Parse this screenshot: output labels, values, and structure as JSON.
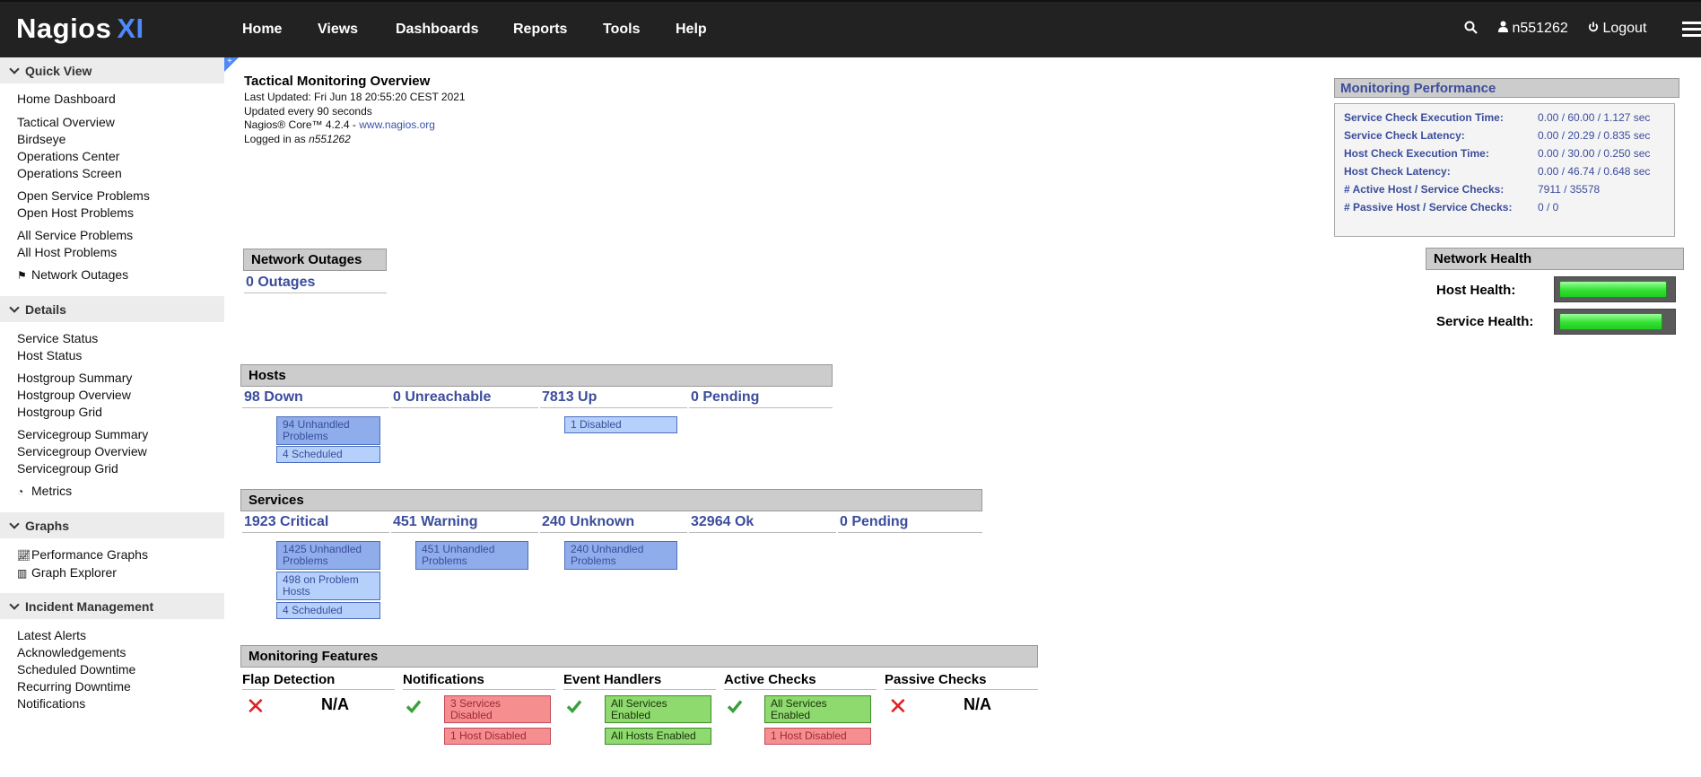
{
  "header": {
    "logo_main": "Nagios",
    "logo_xi": "XI",
    "nav": [
      "Home",
      "Views",
      "Dashboards",
      "Reports",
      "Tools",
      "Help"
    ],
    "username": "n551262",
    "logout_label": "Logout"
  },
  "sidebar": {
    "quick_view": {
      "title": "Quick View",
      "items": [
        "Home Dashboard",
        "Tactical Overview",
        "Birdseye",
        "Operations Center",
        "Operations Screen",
        "Open Service Problems",
        "Open Host Problems",
        "All Service Problems",
        "All Host Problems",
        "Network Outages"
      ]
    },
    "details": {
      "title": "Details",
      "items": [
        "Service Status",
        "Host Status",
        "Hostgroup Summary",
        "Hostgroup Overview",
        "Hostgroup Grid",
        "Servicegroup Summary",
        "Servicegroup Overview",
        "Servicegroup Grid",
        "Metrics"
      ]
    },
    "graphs": {
      "title": "Graphs",
      "items": [
        "Performance Graphs",
        "Graph Explorer"
      ]
    },
    "incident": {
      "title": "Incident Management",
      "items": [
        "Latest Alerts",
        "Acknowledgements",
        "Scheduled Downtime",
        "Recurring Downtime",
        "Notifications"
      ]
    }
  },
  "overview": {
    "title": "Tactical Monitoring Overview",
    "last_updated": "Last Updated: Fri Jun 18 20:55:20 CEST 2021",
    "update_interval": "Updated every 90 seconds",
    "core_version": "Nagios® Core™ 4.2.4 - ",
    "core_link": "www.nagios.org",
    "logged_in_prefix": "Logged in as ",
    "logged_in_user": "n551262"
  },
  "performance": {
    "title": "Monitoring Performance",
    "rows": [
      {
        "label": "Service Check Execution Time:",
        "value": "0.00 / 60.00 / 1.127 sec"
      },
      {
        "label": "Service Check Latency:",
        "value": "0.00 / 20.29 / 0.835 sec"
      },
      {
        "label": "Host Check Execution Time:",
        "value": "0.00 / 30.00 / 0.250 sec"
      },
      {
        "label": "Host Check Latency:",
        "value": "0.00 / 46.74 / 0.648 sec"
      },
      {
        "label": "# Active Host / Service Checks:",
        "value": "7911 / 35578"
      },
      {
        "label": "# Passive Host / Service Checks:",
        "value": "0 / 0"
      }
    ]
  },
  "network_outages": {
    "title": "Network Outages",
    "value": "0 Outages"
  },
  "network_health": {
    "title": "Network Health",
    "host_label": "Host Health:",
    "service_label": "Service Health:",
    "host_level": 0.97,
    "service_level": 0.93
  },
  "hosts": {
    "title": "Hosts",
    "down": "98 Down",
    "unreachable": "0 Unreachable",
    "up": "7813 Up",
    "pending": "0 Pending",
    "down_unhandled": "94 Unhandled Problems",
    "down_scheduled": "4 Scheduled",
    "up_disabled": "1 Disabled"
  },
  "services": {
    "title": "Services",
    "critical": "1923 Critical",
    "warning": "451 Warning",
    "unknown": "240 Unknown",
    "ok": "32964 Ok",
    "pending": "0 Pending",
    "critical_unhandled": "1425 Unhandled Problems",
    "critical_on_problem_hosts": "498 on Problem Hosts",
    "critical_scheduled": "4 Scheduled",
    "warning_unhandled": "451 Unhandled Problems",
    "unknown_unhandled": "240 Unhandled Problems"
  },
  "features": {
    "title": "Monitoring Features",
    "flap": {
      "label": "Flap Detection",
      "value": "N/A"
    },
    "notifications": {
      "label": "Notifications",
      "chip1": "3 Services Disabled",
      "chip2": "1 Host Disabled"
    },
    "event_handlers": {
      "label": "Event Handlers",
      "chip1": "All Services Enabled",
      "chip2": "All Hosts Enabled"
    },
    "active_checks": {
      "label": "Active Checks",
      "chip1": "All Services Enabled",
      "chip2": "1 Host Disabled"
    },
    "passive_checks": {
      "label": "Passive Checks",
      "value": "N/A"
    }
  },
  "colors": {
    "topbar": "#222222",
    "accent_blue": "#4d89f9",
    "link_blue": "#3b4d9c",
    "health_green": "#33e033",
    "error_red": "#e02020"
  }
}
